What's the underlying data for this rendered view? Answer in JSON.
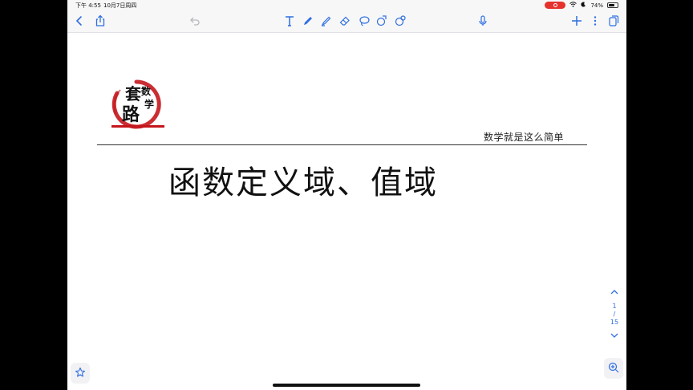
{
  "status_bar": {
    "time": "下午 4:55",
    "date": "10月7日周四",
    "battery_percent": "74%",
    "battery_level": 0.74
  },
  "toolbar": {
    "icons": [
      "back-icon",
      "share-icon",
      "undo-icon",
      "text-tool-icon",
      "pen-icon",
      "highlighter-icon",
      "eraser-icon",
      "lasso-icon",
      "shape-icon",
      "image-tool-icon",
      "microphone-icon",
      "add-icon",
      "more-icon",
      "pages-icon"
    ],
    "accent_color": "#2f6fe0"
  },
  "page": {
    "logo_text": "套路数学",
    "slogan": "数学就是这么简单",
    "title": "函数定义域、值域"
  },
  "pager": {
    "current": "1",
    "separator": "/",
    "total": "15"
  }
}
